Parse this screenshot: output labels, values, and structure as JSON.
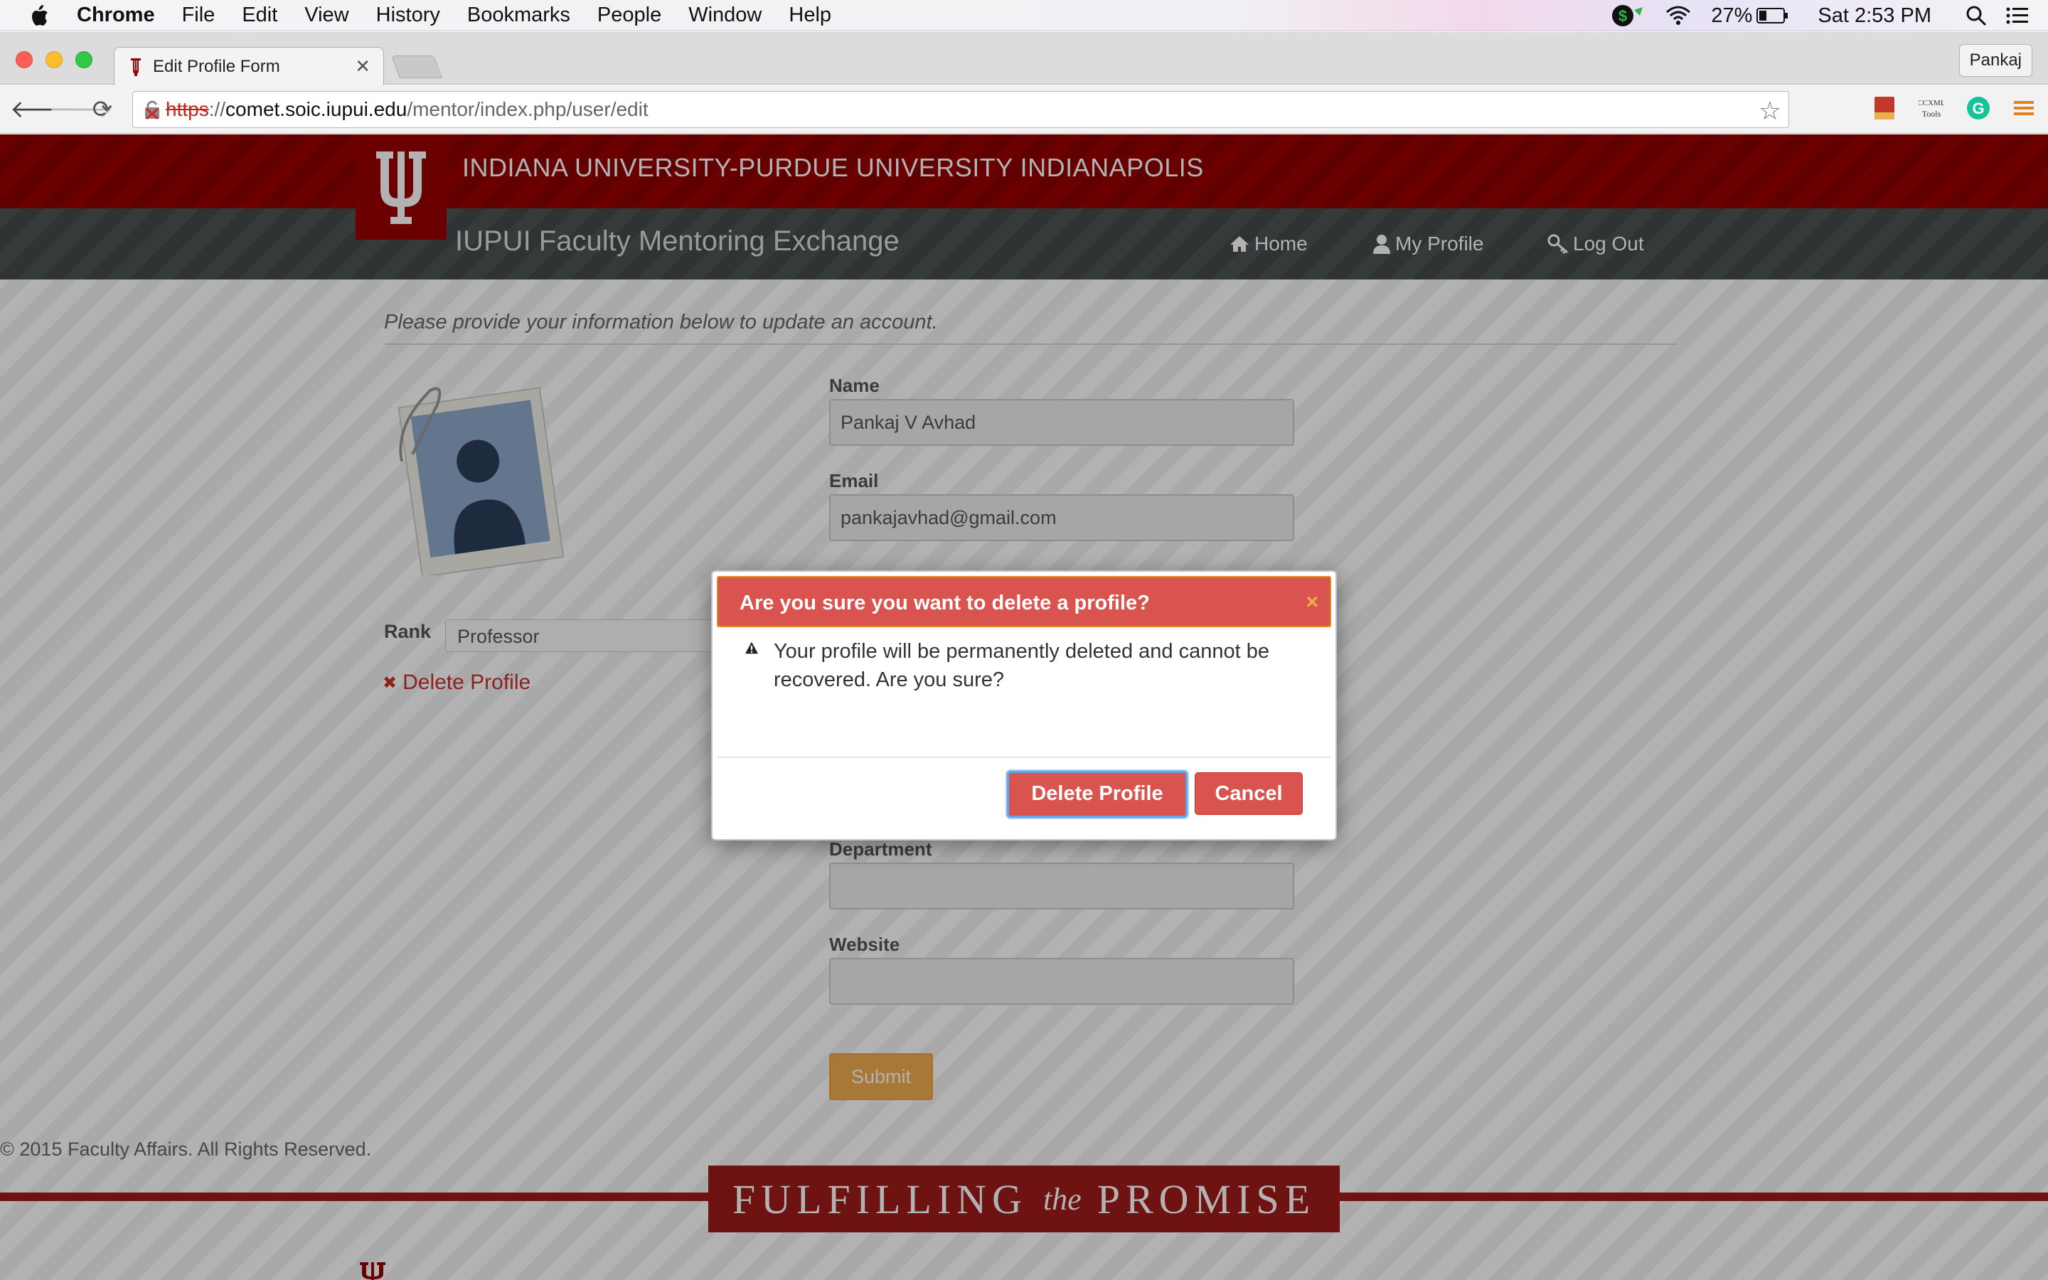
{
  "menubar": {
    "app_name": "Chrome",
    "items": [
      "File",
      "Edit",
      "View",
      "History",
      "Bookmarks",
      "People",
      "Window",
      "Help"
    ],
    "battery": "27%",
    "clock": "Sat 2:53 PM"
  },
  "browser": {
    "tab_title": "Edit Profile Form",
    "profile_name": "Pankaj",
    "url_scheme": "https",
    "url_sep": "://",
    "url_host": "comet.soic.iupui.edu",
    "url_path": "/mentor/index.php/user/edit"
  },
  "site": {
    "university_name": "INDIANA UNIVERSITY-PURDUE UNIVERSITY INDIANAPOLIS",
    "site_title": "IUPUI Faculty Mentoring Exchange",
    "nav": {
      "home": "Home",
      "my_profile": "My Profile",
      "log_out": "Log Out"
    }
  },
  "form": {
    "intro": "Please provide your information below to update an account.",
    "name_label": "Name",
    "name_value": "Pankaj V Avhad",
    "email_label": "Email",
    "email_value": "pankajavhad@gmail.com",
    "department_label": "Department",
    "department_value": "",
    "website_label": "Website",
    "website_value": "",
    "rank_label": "Rank",
    "rank_value": "Professor",
    "delete_link": "Delete Profile",
    "submit": "Submit"
  },
  "footer": {
    "copyright": "© 2015 Faculty Affairs. All Rights Reserved.",
    "promise_left": "FULFILLING",
    "promise_the": "the",
    "promise_right": "PROMISE"
  },
  "modal": {
    "title": "Are you sure you want to delete a profile?",
    "close": "×",
    "message": "Your profile will be permanently deleted and cannot be recovered. Are you sure?",
    "delete_button": "Delete Profile",
    "cancel_button": "Cancel"
  },
  "colors": {
    "iu_crimson": "#990000",
    "danger": "#d9534f",
    "warning": "#f0ad4e",
    "nav_gray": "#4d5353"
  }
}
